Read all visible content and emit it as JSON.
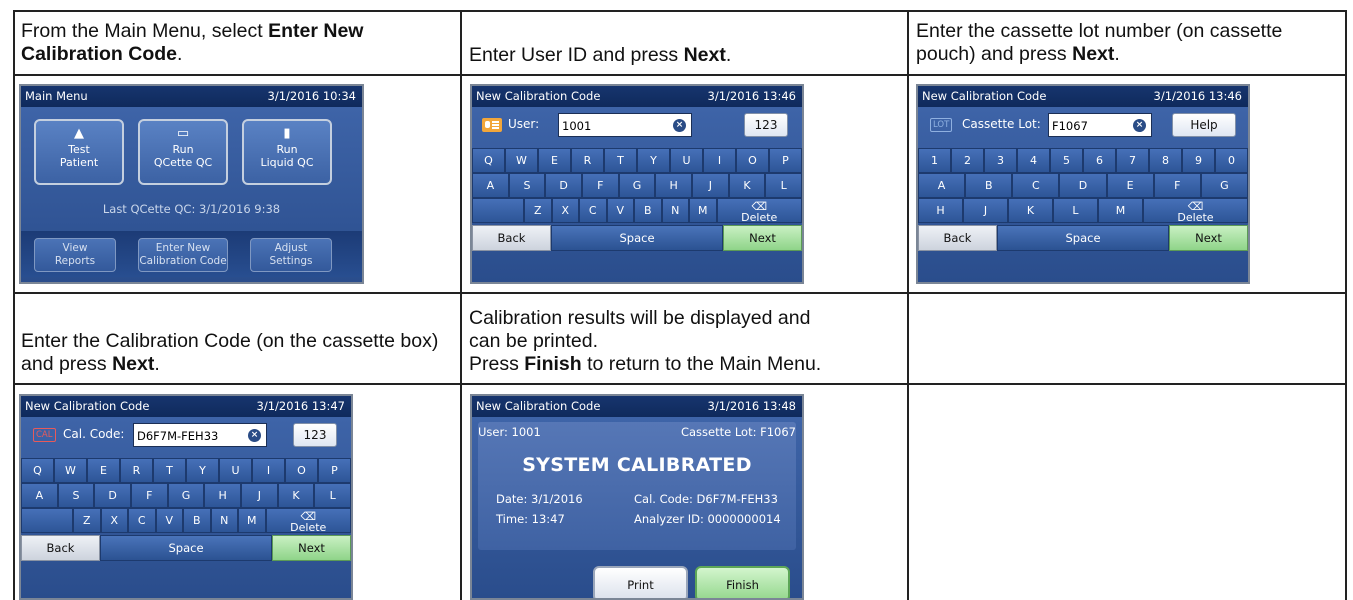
{
  "steps": [
    {
      "instruction_pre": "From the Main Menu, select ",
      "instruction_bold": "Enter New Calibration Code",
      "instruction_post": ".",
      "screen": {
        "title": "Main Menu",
        "datetime": "3/1/2016 10:34",
        "buttons": [
          {
            "icon": "test-patient-icon",
            "line1": "Test",
            "line2": "Patient"
          },
          {
            "icon": "qcette-icon",
            "line1": "Run",
            "line2": "QCette QC"
          },
          {
            "icon": "liquid-qc-icon",
            "line1": "Run",
            "line2": "Liquid QC"
          }
        ],
        "status": "Last QCette QC: 3/1/2016 9:38",
        "bottom_buttons": [
          {
            "line1": "View",
            "line2": "Reports"
          },
          {
            "line1": "Enter New",
            "line2": "Calibration Code"
          },
          {
            "line1": "Adjust",
            "line2": "Settings"
          }
        ]
      }
    },
    {
      "instruction_pre": "Enter User ID and press ",
      "instruction_bold": "Next",
      "instruction_post": ".",
      "screen": {
        "title": "New Calibration Code",
        "datetime": "3/1/2016 13:46",
        "field_label": "User:",
        "field_value": "1001",
        "side_button": "123"
      }
    },
    {
      "instruction_pre": "Enter the cassette lot number (on cassette pouch) and press ",
      "instruction_bold": "Next",
      "instruction_post": ".",
      "screen": {
        "title": "New Calibration Code",
        "datetime": "3/1/2016 13:46",
        "tag": "LOT",
        "field_label": "Cassette Lot:",
        "field_value": "F1067",
        "side_button": "Help"
      }
    },
    {
      "instruction_pre": "Enter the Calibration Code (on the cassette box) and press ",
      "instruction_bold": "Next",
      "instruction_post": ".",
      "screen": {
        "title": "New Calibration Code",
        "datetime": "3/1/2016 13:47",
        "tag": "CAL",
        "field_label": "Cal. Code:",
        "field_value": "D6F7M-FEH33",
        "side_button": "123"
      }
    },
    {
      "instruction_line1": "Calibration results will be displayed and",
      "instruction_line2": "can be printed.",
      "instruction_pre": "Press ",
      "instruction_bold": "Finish",
      "instruction_post": " to return to the Main Menu.",
      "screen": {
        "title": "New Calibration Code",
        "datetime": "3/1/2016 13:48",
        "user": "User: 1001",
        "cassette_lot": "Cassette Lot: F1067",
        "headline": "SYSTEM CALIBRATED",
        "date": "Date: 3/1/2016",
        "time": "Time: 13:47",
        "cal_code": "Cal. Code: D6F7M-FEH33",
        "analyzer_id": "Analyzer ID: 0000000014",
        "print_label": "Print",
        "finish_label": "Finish"
      }
    }
  ],
  "keyboard": {
    "row1": [
      "Q",
      "W",
      "E",
      "R",
      "T",
      "Y",
      "U",
      "I",
      "O",
      "P"
    ],
    "row2": [
      "A",
      "S",
      "D",
      "F",
      "G",
      "H",
      "J",
      "K",
      "L"
    ],
    "row3": [
      "Z",
      "X",
      "C",
      "V",
      "B",
      "N",
      "M"
    ],
    "delete_label": "Delete",
    "delete_glyph": "⌫"
  },
  "lot_keyboard": {
    "row1": [
      "1",
      "2",
      "3",
      "4",
      "5",
      "6",
      "7",
      "8",
      "9",
      "0"
    ],
    "row2": [
      "A",
      "B",
      "C",
      "D",
      "E",
      "F",
      "G"
    ],
    "row3": [
      "H",
      "J",
      "K",
      "L",
      "M"
    ]
  },
  "bottom_bar": {
    "back": "Back",
    "space": "Space",
    "next": "Next"
  },
  "colors": {
    "title_bar": "#0f2a5c",
    "screen_bg": "#2c4f8c",
    "next_green": "#8fd489",
    "key_blue": "#3b63a8"
  }
}
